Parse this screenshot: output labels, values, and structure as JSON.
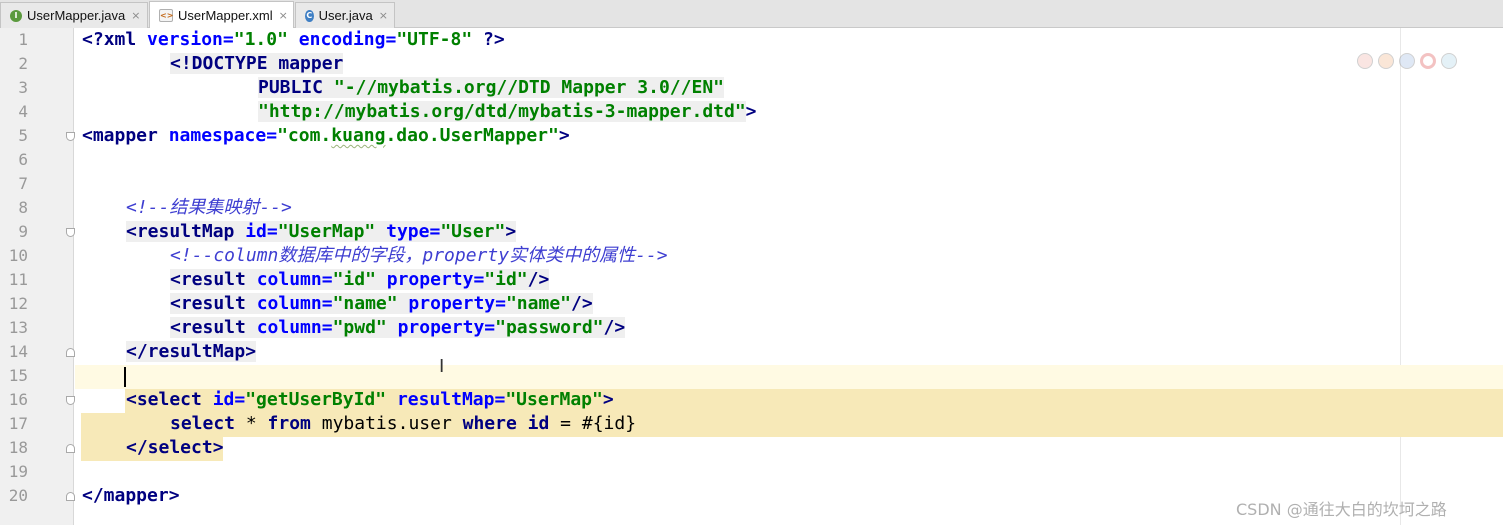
{
  "tabs": [
    {
      "label": "UserMapper.java",
      "icon": "I",
      "icon_name": "interface-file-icon"
    },
    {
      "label": "UserMapper.xml",
      "icon": "<>",
      "icon_name": "xml-file-icon",
      "active": true
    },
    {
      "label": "User.java",
      "icon": "C",
      "icon_name": "class-file-icon"
    }
  ],
  "tab_close_glyph": "×",
  "line_numbers": [
    "1",
    "2",
    "3",
    "4",
    "5",
    "6",
    "7",
    "8",
    "9",
    "10",
    "11",
    "12",
    "13",
    "14",
    "15",
    "16",
    "17",
    "18",
    "19",
    "20"
  ],
  "code": {
    "l1": {
      "open": "<?",
      "name": "xml",
      "a1": " version=",
      "v1": "\"1.0\"",
      "a2": " encoding=",
      "v2": "\"UTF-8\"",
      "close": " ?>"
    },
    "l2": {
      "text": "<!DOCTYPE mapper"
    },
    "l3": {
      "kw": "PUBLIC ",
      "val": "\"-//mybatis.org//DTD Mapper 3.0//EN\""
    },
    "l4": {
      "val": "\"http://mybatis.org/dtd/mybatis-3-mapper.dtd\"",
      "close": ">"
    },
    "l5": {
      "open": "<mapper",
      "attr": " namespace=",
      "q1": "\"",
      "v_a": "com.",
      "v_b": "kuang",
      "v_c": ".dao.UserMapper",
      "q2": "\"",
      "close": ">"
    },
    "l8": {
      "comment": "<!--结果集映射-->"
    },
    "l9": {
      "open": "<resultMap",
      "a1": " id=",
      "v1": "\"UserMap\"",
      "a2": " type=",
      "v2": "\"User\"",
      "close": ">"
    },
    "l10": {
      "comment": "<!--column数据库中的字段，property实体类中的属性-->"
    },
    "l11": {
      "open": "<result",
      "a1": " column=",
      "v1": "\"id\"",
      "a2": " property=",
      "v2": "\"id\"",
      "close": "/>"
    },
    "l12": {
      "open": "<result",
      "a1": " column=",
      "v1": "\"name\"",
      "a2": " property=",
      "v2": "\"name\"",
      "close": "/>"
    },
    "l13": {
      "open": "<result",
      "a1": " column=",
      "v1": "\"pwd\"",
      "a2": " property=",
      "v2": "\"password\"",
      "close": "/>"
    },
    "l14": {
      "text": "</resultMap>"
    },
    "l16": {
      "open": "<select",
      "a1": " id=",
      "v1": "\"getUserById\"",
      "a2": " resultMap=",
      "v2": "\"UserMap\"",
      "close": ">"
    },
    "l17": {
      "k1": "select",
      "p1": " * ",
      "k2": "from",
      "p2": " mybatis.user ",
      "k3": "where",
      "p3": " ",
      "k4": "id",
      "p4": " = #{id}"
    },
    "l18": {
      "text": "</select>"
    },
    "l20": {
      "text": "</mapper>"
    }
  },
  "browser_icons": [
    "chrome-icon",
    "firefox-icon",
    "safari-icon",
    "opera-icon",
    "edge-icon"
  ],
  "watermark": "CSDN @通往大白的坎坷之路"
}
